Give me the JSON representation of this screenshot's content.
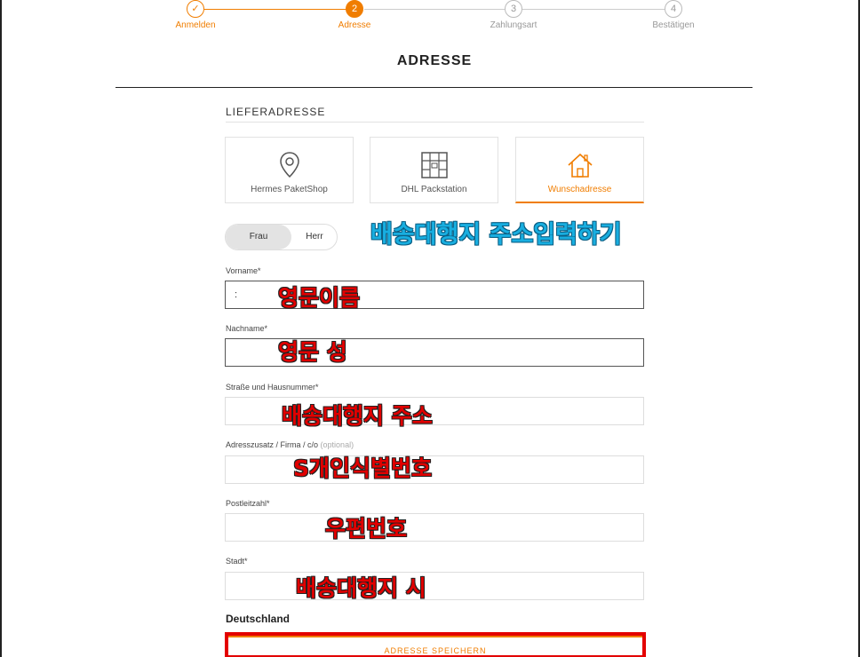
{
  "stepper": {
    "steps": [
      {
        "number": "✓",
        "label": "Anmelden",
        "state": "done"
      },
      {
        "number": "2",
        "label": "Adresse",
        "state": "active"
      },
      {
        "number": "3",
        "label": "Zahlungsart",
        "state": "pending"
      },
      {
        "number": "4",
        "label": "Bestätigen",
        "state": "pending"
      }
    ]
  },
  "page_title": "ADRESSE",
  "section_title": "LIEFERADRESSE",
  "delivery_options": [
    {
      "label": "Hermes PaketShop",
      "icon": "location-pin-icon"
    },
    {
      "label": "DHL Packstation",
      "icon": "packstation-icon"
    },
    {
      "label": "Wunschadresse",
      "icon": "house-icon",
      "selected": true
    }
  ],
  "gender": {
    "frau": "Frau",
    "herr": "Herr",
    "selected": "Frau"
  },
  "fields": {
    "vorname": {
      "label": "Vorname*",
      "value": ":"
    },
    "nachname": {
      "label": "Nachname*",
      "value": ""
    },
    "strasse": {
      "label": "Straße und Hausnummer*",
      "value": ""
    },
    "adresszusatz": {
      "label": "Adresszusatz / Firma / c/o",
      "optional": "(optional)",
      "value": ""
    },
    "postleitzahl": {
      "label": "Postleitzahl*",
      "value": ""
    },
    "stadt": {
      "label": "Stadt*",
      "value": ""
    }
  },
  "country": "Deutschland",
  "save_button": "ADRESSE SPEICHERN",
  "annotations": {
    "header": "배송대행지 주소입력하기",
    "vorname": "영문이름",
    "nachname": "영문 성",
    "strasse": "배송대행지 주소",
    "adresszusatz": "S개인식별번호",
    "postleitzahl": "우편번호",
    "stadt": "배송대행지 시"
  },
  "colors": {
    "accent": "#f07d00",
    "highlight": "#e30000",
    "annotation_red": "#e00000",
    "annotation_blue": "#18aee0"
  }
}
